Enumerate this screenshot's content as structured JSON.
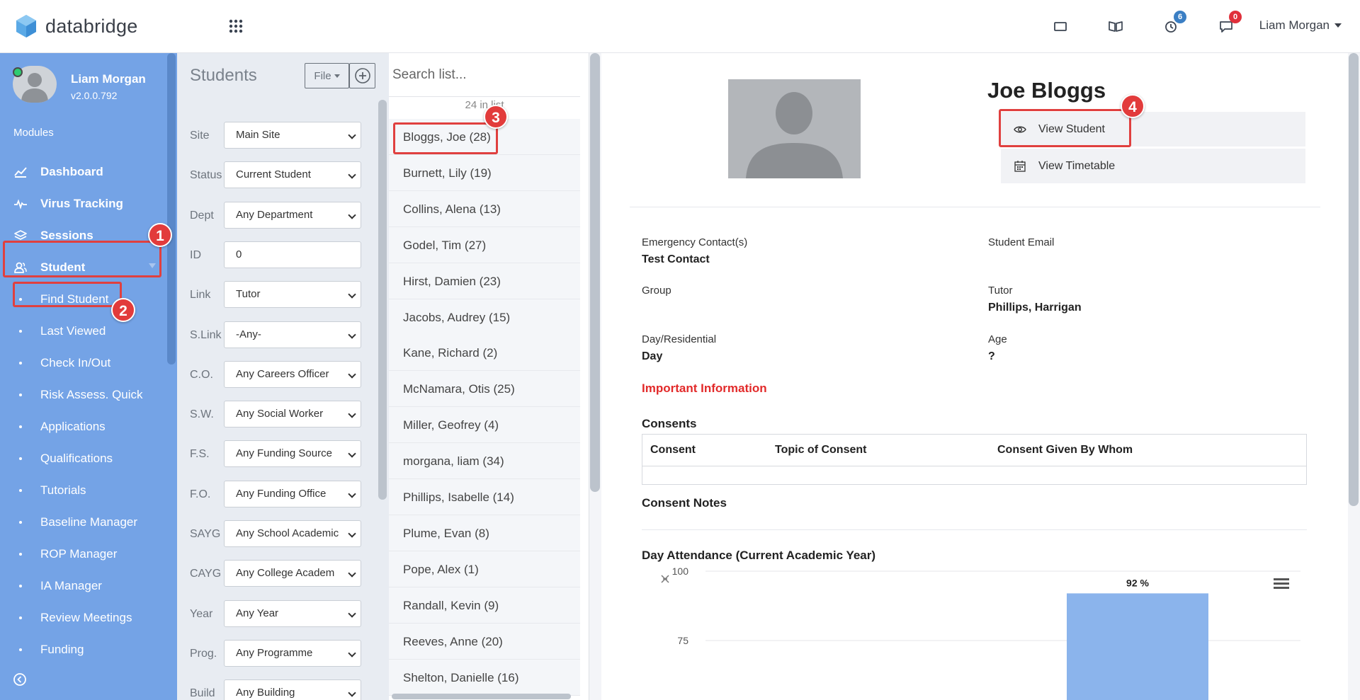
{
  "app": {
    "brand": "databridge"
  },
  "header": {
    "user_name": "Liam Morgan",
    "notifications": [
      {
        "icon": "tablet-icon",
        "count": ""
      },
      {
        "icon": "book-icon",
        "count": ""
      },
      {
        "icon": "clock-icon",
        "count": "6",
        "color": "#3b7fc4"
      },
      {
        "icon": "chat-icon",
        "count": "0",
        "color": "#e0303b"
      }
    ]
  },
  "sidebar": {
    "profile_name": "Liam Morgan",
    "version": "v2.0.0.792",
    "modules_label": "Modules",
    "items": [
      {
        "label": "Dashboard",
        "icon": "chart-line-icon",
        "main": true
      },
      {
        "label": "Virus Tracking",
        "icon": "pulse-icon",
        "main": true
      },
      {
        "label": "Sessions",
        "icon": "layers-icon",
        "main": true
      },
      {
        "label": "Student",
        "icon": "users-icon",
        "main": true
      },
      {
        "label": "Find Student"
      },
      {
        "label": "Last Viewed"
      },
      {
        "label": "Check In/Out"
      },
      {
        "label": "Risk Assess. Quick"
      },
      {
        "label": "Applications"
      },
      {
        "label": "Qualifications"
      },
      {
        "label": "Tutorials"
      },
      {
        "label": "Baseline Manager"
      },
      {
        "label": "ROP Manager"
      },
      {
        "label": "IA Manager"
      },
      {
        "label": "Review Meetings"
      },
      {
        "label": "Funding"
      }
    ]
  },
  "filters": {
    "title": "Students",
    "file_label": "File",
    "rows": [
      {
        "label": "Site",
        "value": "Main Site"
      },
      {
        "label": "Status",
        "value": "Current Student"
      },
      {
        "label": "Dept",
        "value": "Any Department"
      },
      {
        "label": "ID",
        "value": "0",
        "input": true
      },
      {
        "label": "Link",
        "value": "Tutor"
      },
      {
        "label": "S.Link",
        "value": "-Any-"
      },
      {
        "label": "C.O.",
        "value": "Any Careers Officer"
      },
      {
        "label": "S.W.",
        "value": "Any Social Worker"
      },
      {
        "label": "F.S.",
        "value": "Any Funding Source"
      },
      {
        "label": "F.O.",
        "value": "Any Funding Office"
      },
      {
        "label": "SAYG",
        "value": "Any School Academic"
      },
      {
        "label": "CAYG",
        "value": "Any College Academ"
      },
      {
        "label": "Year",
        "value": "Any Year"
      },
      {
        "label": "Prog.",
        "value": "Any Programme"
      },
      {
        "label": "Build",
        "value": "Any Building"
      }
    ]
  },
  "list": {
    "search_placeholder": "Search list...",
    "count_text": "24 in list",
    "items": [
      "Bloggs, Joe (28)",
      "Burnett, Lily (19)",
      "Collins, Alena (13)",
      "Godel, Tim (27)",
      "Hirst, Damien (23)",
      "Jacobs, Audrey (15)",
      "Kane, Richard (2)",
      "McNamara, Otis (25)",
      "Miller, Geofrey (4)",
      "morgana, liam (34)",
      "Phillips, Isabelle (14)",
      "Plume, Evan (8)",
      "Pope, Alex (1)",
      "Randall, Kevin (9)",
      "Reeves, Anne (20)",
      "Shelton, Danielle (16)"
    ]
  },
  "detail": {
    "name": "Joe Bloggs",
    "view_student": "View Student",
    "view_timetable": "View Timetable",
    "fields": {
      "emergency_label": "Emergency Contact(s)",
      "emergency_value": "Test Contact",
      "email_label": "Student Email",
      "email_value": "",
      "group_label": "Group",
      "group_value": "",
      "tutor_label": "Tutor",
      "tutor_value": "Phillips, Harrigan",
      "day_label": "Day/Residential",
      "day_value": "Day",
      "age_label": "Age",
      "age_value": "?"
    },
    "important_label": "Important Information",
    "consents_title": "Consents",
    "consent_headers": [
      "Consent",
      "Topic of Consent",
      "Consent Given By Whom"
    ],
    "consent_notes_title": "Consent Notes"
  },
  "chart_data": {
    "type": "bar",
    "title": "Day Attendance (Current Academic Year)",
    "categories": [
      ""
    ],
    "values": [
      92
    ],
    "data_labels": [
      "92 %"
    ],
    "y_ticks": [
      "100",
      "75"
    ],
    "ylim": [
      0,
      100
    ],
    "bar_color": "#8bb4ec",
    "grid": true
  },
  "annotations": [
    "1",
    "2",
    "3",
    "4"
  ]
}
